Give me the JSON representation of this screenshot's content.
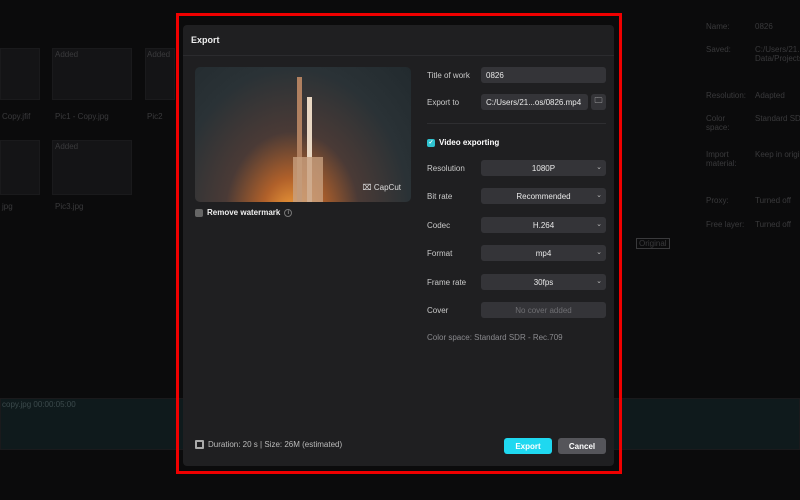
{
  "background": {
    "media_added": [
      "Added",
      "Added",
      "Added"
    ],
    "media_names": [
      "Copy.jfif",
      "Pic1 - Copy.jpg",
      "Pic2",
      "jpg",
      "Pic3.jpg"
    ],
    "properties": [
      {
        "label": "Name:",
        "value": "0826"
      },
      {
        "label": "Saved:",
        "value": "C:/Users/21.../User Data/Projects/0826"
      },
      {
        "label": "Resolution:",
        "value": "Adapted"
      },
      {
        "label": "Color space:",
        "value": "Standard SDR"
      },
      {
        "label": "Import material:",
        "value": "Keep in original"
      },
      {
        "label": "Proxy:",
        "value": "Turned off"
      },
      {
        "label": "Free layer:",
        "value": "Turned off"
      }
    ],
    "original_label": "Original",
    "clip_label": "copy.jpg  00:00:05:00"
  },
  "dialog": {
    "title": "Export",
    "watermark_text": "CapCut",
    "remove_watermark": "Remove watermark",
    "title_of_work_label": "Title of work",
    "title_of_work": "0826",
    "export_to_label": "Export to",
    "export_to": "C:/Users/21...os/0826.mp4",
    "video_exporting": "Video exporting",
    "video_exporting_checked": true,
    "settings": [
      {
        "label": "Resolution",
        "value": "1080P"
      },
      {
        "label": "Bit rate",
        "value": "Recommended"
      },
      {
        "label": "Codec",
        "value": "H.264"
      },
      {
        "label": "Format",
        "value": "mp4"
      },
      {
        "label": "Frame rate",
        "value": "30fps"
      }
    ],
    "cover_label": "Cover",
    "cover_value": "No cover added",
    "color_space": "Color space:  Standard SDR - Rec.709",
    "footer_info": "Duration: 20 s | Size: 26M (estimated)",
    "export_button": "Export",
    "cancel_button": "Cancel",
    "accent_color": "#1fd8f0"
  }
}
